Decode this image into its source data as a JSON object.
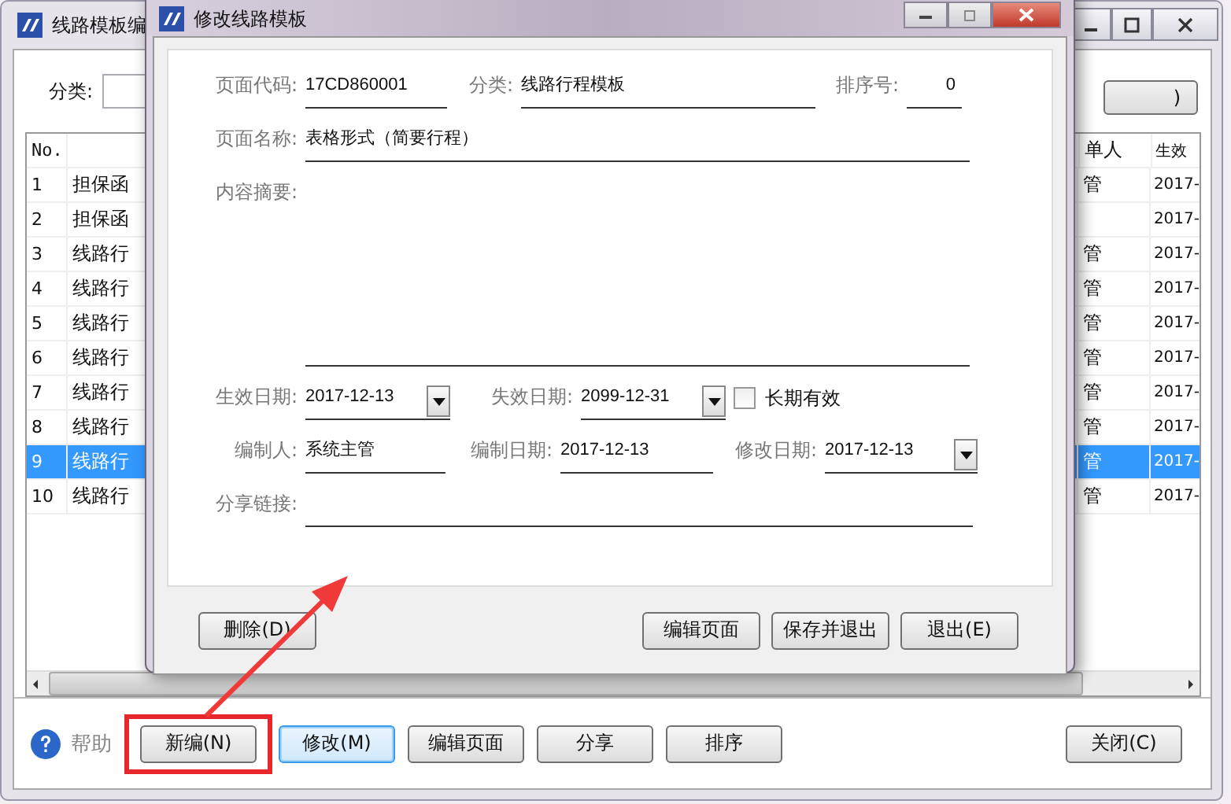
{
  "main_window": {
    "title": "线路模板编",
    "category_label": "分类:",
    "top_button": ")",
    "table": {
      "columns": [
        "No.",
        "单人",
        "生效"
      ],
      "rows": [
        {
          "no": "1",
          "name": "担保函",
          "person": "管",
          "date": "2017-",
          "selected": false
        },
        {
          "no": "2",
          "name": "担保函",
          "date": "2017-",
          "selected": false
        },
        {
          "no": "3",
          "name": "线路行",
          "person": "管",
          "date": "2017-",
          "selected": false
        },
        {
          "no": "4",
          "name": "线路行",
          "person": "管",
          "date": "2017-",
          "selected": false
        },
        {
          "no": "5",
          "name": "线路行",
          "person": "管",
          "date": "2017-",
          "selected": false
        },
        {
          "no": "6",
          "name": "线路行",
          "person": "管",
          "date": "2017-",
          "selected": false
        },
        {
          "no": "7",
          "name": "线路行",
          "person": "管",
          "date": "2017-",
          "selected": false
        },
        {
          "no": "8",
          "name": "线路行",
          "person": "管",
          "date": "2017-",
          "selected": false
        },
        {
          "no": "9",
          "name": "线路行",
          "person": "管",
          "date": "2017-",
          "selected": true
        },
        {
          "no": "10",
          "name": "线路行",
          "person": "管",
          "date": "2017-",
          "selected": false
        }
      ]
    },
    "help": "帮助",
    "buttons": [
      {
        "label": "新编(N)",
        "highlighted": true,
        "focused": false
      },
      {
        "label": "修改(M)",
        "highlighted": false,
        "focused": true
      },
      {
        "label": "编辑页面",
        "highlighted": false,
        "focused": false
      },
      {
        "label": "分享",
        "highlighted": false,
        "focused": false
      },
      {
        "label": "排序",
        "highlighted": false,
        "focused": false
      }
    ],
    "close_button": "关闭(C)"
  },
  "dialog": {
    "title": "修改线路模板",
    "rows": [
      {
        "fields": [
          {
            "kind": "text",
            "label": "页面代码:",
            "value": "17CD860001"
          },
          {
            "kind": "text",
            "label": "分类:",
            "value": "线路行程模板"
          },
          {
            "kind": "text",
            "label": "排序号:",
            "value": "0"
          }
        ]
      },
      {
        "fields": [
          {
            "kind": "text",
            "label": "页面名称:",
            "value": "表格形式（简要行程）"
          }
        ]
      },
      {
        "fields": [
          {
            "kind": "area",
            "label": "内容摘要:"
          }
        ]
      },
      {
        "fields": [
          {
            "kind": "date",
            "label": "生效日期:",
            "value": "2017-12-13"
          },
          {
            "kind": "date",
            "label": "失效日期:",
            "value": "2099-12-31"
          },
          {
            "kind": "checkbox",
            "label": "长期有效",
            "checked": false
          }
        ]
      },
      {
        "fields": [
          {
            "kind": "text",
            "label": "编制人:",
            "value": "系统主管"
          },
          {
            "kind": "text",
            "label": "编制日期:",
            "value": "2017-12-13"
          },
          {
            "kind": "date",
            "label": "修改日期:",
            "value": "2017-12-13"
          }
        ]
      },
      {
        "fields": [
          {
            "kind": "text",
            "label": "分享链接:"
          }
        ]
      }
    ],
    "left_buttons": [
      "删除(D)"
    ],
    "right_buttons": [
      "编辑页面",
      "保存并退出",
      "退出(E)"
    ]
  }
}
